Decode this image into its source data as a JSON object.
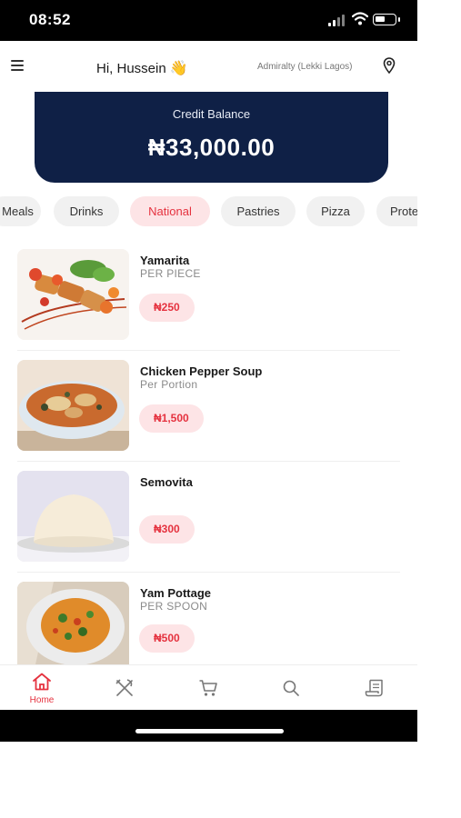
{
  "status_bar": {
    "time": "08:52"
  },
  "header": {
    "greeting": "Hi, Hussein",
    "greeting_emoji": "👋",
    "location": "Admiralty (Lekki Lagos)"
  },
  "credit": {
    "label": "Credit Balance",
    "amount": "₦33,000.00"
  },
  "categories": [
    "Meals",
    "Drinks",
    "National",
    "Pastries",
    "Pizza",
    "Prote"
  ],
  "selected_category": "National",
  "items": [
    {
      "name": "Yamarita",
      "unit": "PER PIECE",
      "price": "₦250"
    },
    {
      "name": "Chicken Pepper Soup",
      "unit": "Per Portion",
      "price": "₦1,500"
    },
    {
      "name": "Semovita",
      "unit": "",
      "price": "₦300"
    },
    {
      "name": "Yam Pottage",
      "unit": "PER SPOON",
      "price": "₦500"
    }
  ],
  "bottom_nav": {
    "items": [
      {
        "icon": "home-icon",
        "label": "Home",
        "active": true
      },
      {
        "icon": "cutlery-icon"
      },
      {
        "icon": "cart-icon"
      },
      {
        "icon": "search-icon"
      },
      {
        "icon": "receipt-icon"
      }
    ]
  },
  "colors": {
    "accent": "#e5323f",
    "accent_bg": "#fde4e6",
    "credit_bg": "#0f2046"
  }
}
